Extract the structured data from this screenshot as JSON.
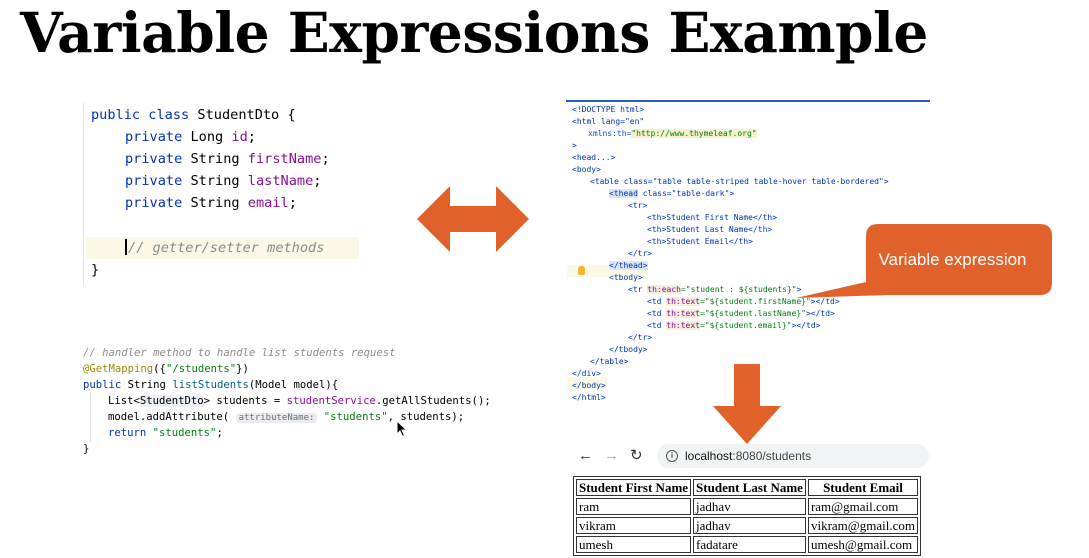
{
  "title": "Variable Expressions Example",
  "java_class": {
    "line1": {
      "kw": "public class",
      "name": " StudentDto {"
    },
    "line2": {
      "kw": "private",
      "type": " Long ",
      "field": "id",
      "end": ";"
    },
    "line3": {
      "kw": "private",
      "type": " String ",
      "field": "firstName",
      "end": ";"
    },
    "line4": {
      "kw": "private",
      "type": " String ",
      "field": "lastName",
      "end": ";"
    },
    "line5": {
      "kw": "private",
      "type": " String ",
      "field": "email",
      "end": ";"
    },
    "comment": "// getter/setter methods",
    "close": "}"
  },
  "controller": {
    "comment": "// handler method to handle list students request",
    "annotation": "@GetMapping",
    "annotation_args_open": "({",
    "annotation_value": "\"/students\"",
    "annotation_args_close": "})",
    "sig_kw": "public",
    "sig_type": " String ",
    "sig_method": "listStudents",
    "sig_params": "(Model model){",
    "l1_a": "List<",
    "l1_type": "StudentDto",
    "l1_b": "> students = ",
    "l1_service": "studentService",
    "l1_c": ".getAllStudents();",
    "l2_a": "model.addAttribute( ",
    "l2_hint": "attributeName:",
    "l2_str": " \"students\"",
    "l2_b": ", students);",
    "l3_kw": "return",
    "l3_str": " \"students\"",
    "l3_end": ";",
    "close": "}"
  },
  "html_code": {
    "doctype": "<!DOCTYPE html>",
    "html_open": "<html lang=\"en\"",
    "xmlns_attr": "xmlns:th=",
    "xmlns_val": "\"http://www.thymeleaf.org\"",
    "gt": ">",
    "head": "<head...>",
    "body_open": "<body>",
    "table_open": "<table class=\"table table-striped table-hover table-bordered\">",
    "thead_open_tag": "<thead",
    "thead_open_rest": " class=\"table-dark\">",
    "tr_open": "<tr>",
    "th1": "<th>Student First Name</th>",
    "th2": "<th>Student Last Name</th>",
    "th3": "<th>Student Email</th>",
    "tr_close": "</tr>",
    "thead_close": "</thead>",
    "tbody_open": "<tbody>",
    "tr_each_a": "<tr ",
    "tr_each_attr": "th:each",
    "tr_each_val": "=\"student : ${students}\"",
    "tr_each_end": ">",
    "td_a": "<td ",
    "td_attr": "th:text",
    "td1_val": "=\"${student.firstName}\"",
    "td2_val": "=\"${student.lastName}\"",
    "td3_val": "=\"${student.email}\"",
    "td_end": "></td>",
    "tbody_close": "</tbody>",
    "table_close": "</table>",
    "div_close": "</div>",
    "body_close": "</body>",
    "html_close": "</html>"
  },
  "callout": {
    "label": "Variable expression",
    "color": "#e0622a"
  },
  "arrow_color": "#e0622a",
  "browser": {
    "url_host": "localhost",
    "url_rest": ":8080/students",
    "back_icon": "arrow-left-icon",
    "forward_icon": "arrow-right-icon",
    "reload_icon": "reload-icon"
  },
  "students_table": {
    "headers": [
      "Student First Name",
      "Student Last Name",
      "Student Email"
    ],
    "rows": [
      [
        "ram",
        "jadhav",
        "ram@gmail.com"
      ],
      [
        "vikram",
        "jadhav",
        "vikram@gmail.com"
      ],
      [
        "umesh",
        "fadatare",
        "umesh@gmail.com"
      ]
    ]
  }
}
